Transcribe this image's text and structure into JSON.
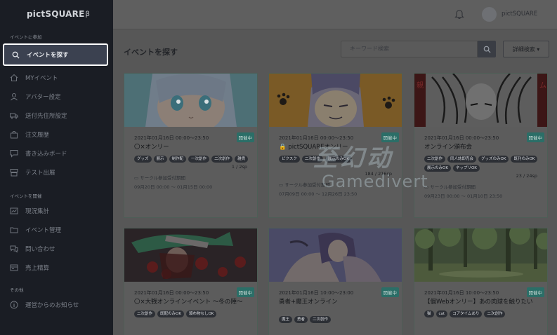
{
  "app": {
    "logo": "pictSQUARE",
    "logo_suffix": "β"
  },
  "sidebar": {
    "section_join": "イベントに参加",
    "join_items": [
      {
        "label": "イベントを探す",
        "icon": "search-icon"
      },
      {
        "label": "MYイベント",
        "icon": "home-icon"
      },
      {
        "label": "アバター設定",
        "icon": "avatar-icon"
      },
      {
        "label": "送付先住所設定",
        "icon": "truck-icon"
      },
      {
        "label": "注文履歴",
        "icon": "bag-icon"
      },
      {
        "label": "書き込みボード",
        "icon": "comment-icon"
      },
      {
        "label": "テスト出展",
        "icon": "booth-icon"
      }
    ],
    "section_host": "イベントを開催",
    "host_items": [
      {
        "label": "現況集計",
        "icon": "chart-icon"
      },
      {
        "label": "イベント管理",
        "icon": "folder-icon"
      },
      {
        "label": "問い合わせ",
        "icon": "chat-icon"
      },
      {
        "label": "売上精算",
        "icon": "receipt-icon"
      }
    ],
    "section_other": "その他",
    "other_items": [
      {
        "label": "運営からのお知らせ",
        "icon": "info-icon"
      }
    ]
  },
  "topbar": {
    "user_name": "pictSQUARE"
  },
  "main": {
    "title": "イベントを探す",
    "search_placeholder": "キーワード検索",
    "advanced_search": "詳細検索 ▾"
  },
  "cards": [
    {
      "date": "2021年01月16日 00:00〜23:50",
      "status": "開催中",
      "title": "〇×オンリー",
      "tags": [
        "グッズ",
        "展示",
        "制作配",
        "一次創作",
        "二次創作",
        "雑貨"
      ],
      "count": "1 / 2sp",
      "period_label": "サークル参加受付期間",
      "period": "09月20日 00:00 〜 01月15日 00:00"
    },
    {
      "date": "2021年01月16日 00:00〜23:50",
      "status": "開催中",
      "title": "pictSQUAREオンリー",
      "tags": [
        "ピクスク",
        "二次創作",
        "展示のみOK"
      ],
      "count": "184 / 216sp",
      "period_label": "サークル参加受付期間",
      "period": "07月09日 00:00 〜 12月26日 23:50"
    },
    {
      "date": "2021年01月16日 00:00〜23:50",
      "status": "開催中",
      "title": "オンライン頒布会",
      "tags": [
        "二次創作",
        "同人誌即売会",
        "グッズのみOK",
        "既刊のみOK",
        "展示のみOK",
        "ネップリOK"
      ],
      "count": "23 / 24sp",
      "period_label": "サークル参加受付期間",
      "period": "09月23日 00:00 〜 01月10日 23:50"
    },
    {
      "date": "2021年01月16日 00:00〜23:50",
      "status": "開催中",
      "title": "〇×大戦オンラインイベント 〜冬の陣〜",
      "tags": [
        "二次創作",
        "既配のみOK",
        "頒布物なしOK"
      ]
    },
    {
      "date": "2021年01月16日 10:00〜23:00",
      "status": "開催中",
      "title": "勇者+魔王オンライン",
      "tags": [
        "魔王",
        "勇者",
        "二次創作"
      ]
    },
    {
      "date": "2021年01月16日 10:00〜23:50",
      "status": "開催中",
      "title": "【個Webオンリー】あの肉球を触りたい",
      "tags": [
        "猫",
        "cat",
        "コアタイムあり",
        "二次創作"
      ]
    }
  ],
  "watermark": {
    "cn": "至幻动",
    "en": "Gamedivert"
  }
}
